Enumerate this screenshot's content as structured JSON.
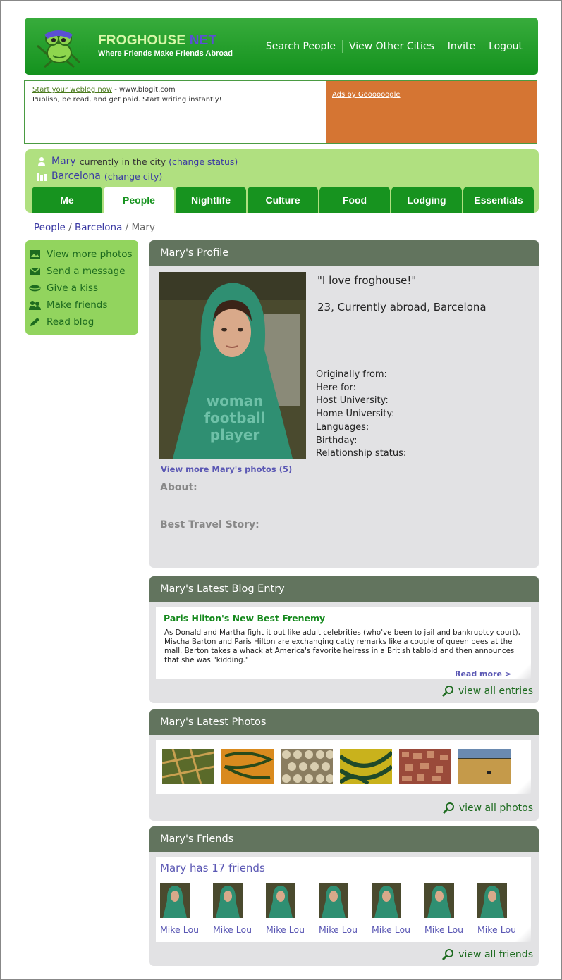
{
  "brand": {
    "name": "FROGHOUSE",
    "suffix": "NET",
    "tagline": "Where Friends Make Friends Abroad"
  },
  "topnav": [
    "Search People",
    "View Other Cities",
    "Invite",
    "Logout"
  ],
  "ad": {
    "link": "Start your weblog now",
    "url": " - www.blogit.com",
    "text": "Publish, be read, and get paid. Start writing instantly!",
    "google": "Ads by Goooooogle"
  },
  "status": {
    "name": "Mary",
    "location_text": "currently in the city",
    "change_status": "(change status)",
    "city": "Barcelona",
    "change_city": "(change city)"
  },
  "tabs": [
    "Me",
    "People",
    "Nightlife",
    "Culture",
    "Food",
    "Lodging",
    "Essentials"
  ],
  "active_tab": "People",
  "breadcrumb": {
    "people": "People",
    "sep1": " / ",
    "city": "Barcelona",
    "sep2": " / ",
    "current": "Mary"
  },
  "side_menu": [
    {
      "label": "View more photos",
      "icon": "photo-icon"
    },
    {
      "label": "Send a message",
      "icon": "envelope-icon"
    },
    {
      "label": "Give a kiss",
      "icon": "lips-icon"
    },
    {
      "label": "Make friends",
      "icon": "people-icon"
    },
    {
      "label": "Read blog",
      "icon": "pencil-icon"
    }
  ],
  "profile": {
    "title": "Mary's Profile",
    "quote": "\"I love froghouse!\"",
    "summary": "23, Currently abroad, Barcelona",
    "facts": [
      "Originally from:",
      "Here for:",
      "Host University:",
      "Home University:",
      "Languages:",
      "Birthday:",
      "Relationship status:"
    ],
    "more_photos": "View more Mary's photos (5)",
    "about": "About:",
    "story": "Best Travel Story:",
    "shirt_text": [
      "woman",
      "football",
      "player"
    ]
  },
  "blog": {
    "title": "Mary's Latest Blog Entry",
    "entry_title": "Paris Hilton's New Best Frenemy",
    "entry_text": "As Donald and Martha fight it out like adult celebrities (who've been to jail and bankruptcy court), Mischa Barton and Paris Hilton are exchanging catty remarks like a couple of queen bees at the mall. Barton takes a whack at America's favorite heiress in a British tabloid and then announces that she was \"kidding.\"",
    "read_more": "Read more >",
    "view_all": "view all entries"
  },
  "photos": {
    "title": "Mary's Latest Photos",
    "view_all": "view all photos",
    "colors": [
      "#6e7a3a",
      "#d98a1e",
      "#b6a98a",
      "#c9b21c",
      "#9a4a3a",
      "#c59a4a"
    ]
  },
  "friends": {
    "title": "Mary's Friends",
    "count_text": "Mary has 17 friends",
    "list": [
      "Mike Lou",
      "Mike Lou",
      "Mike Lou",
      "Mike Lou",
      "Mike Lou",
      "Mike Lou",
      "Mike Lou"
    ],
    "view_all": "view all friends"
  }
}
